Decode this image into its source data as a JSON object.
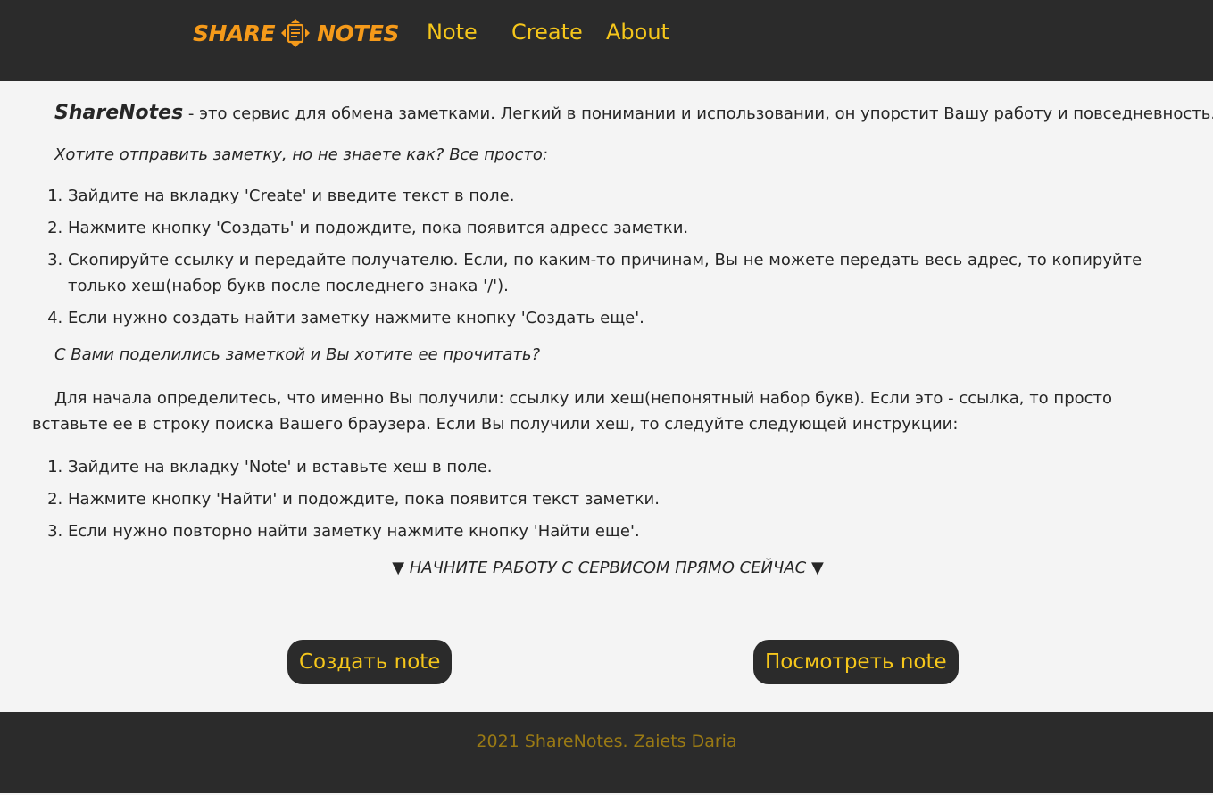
{
  "header": {
    "logo_left": "SHARE",
    "logo_right": "NOTES",
    "logo_icon": "notes-exchange-icon",
    "nav": [
      {
        "label": "Note"
      },
      {
        "label": "Create"
      },
      {
        "label": "About"
      }
    ]
  },
  "intro": {
    "brand": "ShareNotes",
    "text": " - это сервис для обмена заметками. Легкий в понимании и использовании, он упорстит Вашу работу и повседневность."
  },
  "send_section": {
    "question": "Хотите отправить заметку, но не знаете как? Все просто:",
    "steps": [
      "Зайдите на вкладку 'Create' и введите текст в поле.",
      "Нажмите кнопку 'Создать' и подождите, пока появится адресс заметки.",
      "Скопируйте ссылку и передайте получателю. Если, по каким-то причинам, Вы не можете передать весь адрес, то копируйте только хеш(набор букв после последнего знака '/').",
      "Если нужно создать найти заметку нажмите кнопку 'Создать еще'."
    ]
  },
  "read_section": {
    "question": "С Вами поделились заметкой и Вы хотите ее прочитать?",
    "paragraph": "Для начала определитесь, что именно Вы получили: ссылку или хеш(непонятный набор букв). Если это - ссылка, то просто вставьте ее в строку поиска Вашего браузера. Если Вы получили хеш, то следуйте следующей инструкции:",
    "steps": [
      "Зайдите на вкладку 'Note' и вставьте хеш в поле.",
      "Нажмите кнопку 'Найти' и подождите, пока появится текст заметки.",
      "Если нужно повторно найти заметку нажмите кнопку 'Найти еще'."
    ]
  },
  "cta": {
    "arrow": "▼",
    "text": " НАЧНИТЕ РАБОТУ С СЕРВИСОМ ПРЯМО СЕЙЧАС ",
    "create_button": "Создать note",
    "view_button": "Посмотреть note"
  },
  "footer": {
    "text": "2021 ShareNotes. Zaiets Daria"
  },
  "colors": {
    "header_bg": "#2b2b2b",
    "logo": "#f59a1a",
    "nav": "#f5c61b",
    "footer_text": "#9a7a14",
    "page_bg": "#f4f4f4"
  }
}
